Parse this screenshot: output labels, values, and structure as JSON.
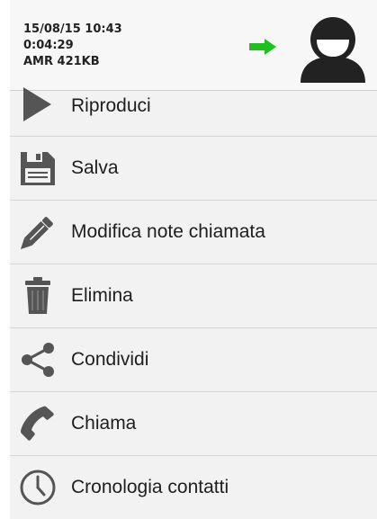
{
  "header": {
    "date_time": "15/08/15  10:43",
    "duration": "0:04:29",
    "file_info": "AMR 421KB",
    "arrow_color": "#1fbf1f",
    "icons": {
      "arrow": "right-arrow-icon",
      "avatar": "contact-avatar-icon"
    }
  },
  "menu": {
    "items": [
      {
        "label": "Riproduci",
        "icon": "play-icon"
      },
      {
        "label": "Salva",
        "icon": "floppy-disk-icon"
      },
      {
        "label": "Modifica note chiamata",
        "icon": "pencil-icon"
      },
      {
        "label": "Elimina",
        "icon": "trash-icon"
      },
      {
        "label": "Condividi",
        "icon": "share-icon"
      },
      {
        "label": "Chiama",
        "icon": "phone-icon"
      },
      {
        "label": "Cronologia contatti",
        "icon": "clock-icon"
      }
    ]
  },
  "colors": {
    "icon": "#555555",
    "text": "#1e1e1e",
    "background": "#f2f2f2"
  }
}
